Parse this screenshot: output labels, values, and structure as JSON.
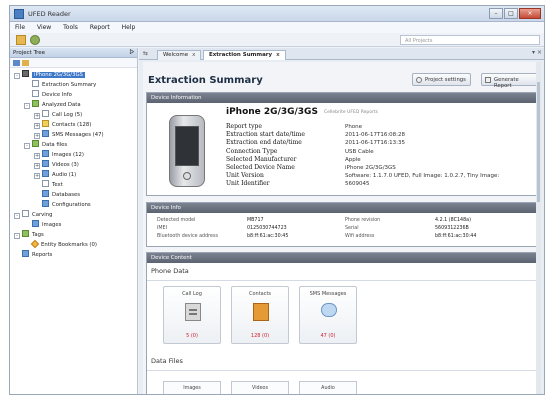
{
  "window": {
    "title": "UFED Reader"
  },
  "menu": [
    "File",
    "View",
    "Tools",
    "Report",
    "Help"
  ],
  "search": {
    "placeholder": "All Projects"
  },
  "left_panel": {
    "header": "Project Tree",
    "tree": [
      {
        "label": "iPhone 2G/3G/3GS",
        "level": 0,
        "icon": "phone-icon",
        "expander": "-",
        "selected": true
      },
      {
        "label": "Extraction Summary",
        "level": 1,
        "icon": "document-icon"
      },
      {
        "label": "Device Info",
        "level": 1,
        "icon": "document-icon"
      },
      {
        "label": "Analyzed Data",
        "level": 1,
        "icon": "analyzed-data-icon",
        "expander": "-"
      },
      {
        "label": "Call Log (5)",
        "level": 2,
        "icon": "call-log-icon",
        "expander": "+"
      },
      {
        "label": "Contacts (128)",
        "level": 2,
        "icon": "contacts-icon",
        "expander": "+"
      },
      {
        "label": "SMS Messages (47)",
        "level": 2,
        "icon": "sms-icon",
        "expander": "+"
      },
      {
        "label": "Data files",
        "level": 1,
        "icon": "data-files-icon",
        "expander": "-"
      },
      {
        "label": "Images (12)",
        "level": 2,
        "icon": "images-icon",
        "expander": "+"
      },
      {
        "label": "Videos (3)",
        "level": 2,
        "icon": "videos-icon",
        "expander": "+"
      },
      {
        "label": "Audio (1)",
        "level": 2,
        "icon": "audio-icon",
        "expander": "+"
      },
      {
        "label": "Text",
        "level": 2,
        "icon": "text-icon"
      },
      {
        "label": "Databases",
        "level": 2,
        "icon": "database-icon"
      },
      {
        "label": "Configurations",
        "level": 2,
        "icon": "configuration-icon"
      },
      {
        "label": "Carving",
        "level": 0,
        "icon": "carving-icon",
        "expander": "-"
      },
      {
        "label": "Images",
        "level": 1,
        "icon": "images-icon"
      },
      {
        "label": "Tags",
        "level": 0,
        "icon": "tags-icon",
        "expander": "-"
      },
      {
        "label": "Entity Bookmarks (0)",
        "level": 1,
        "icon": "bookmark-icon"
      },
      {
        "label": "Reports",
        "level": 0,
        "icon": "reports-icon"
      }
    ]
  },
  "tabs": [
    {
      "label": "Welcome",
      "close": "x"
    },
    {
      "label": "Extraction Summary",
      "close": "x"
    }
  ],
  "summary": {
    "title": "Extraction Summary",
    "project_settings": "Project settings",
    "generate_report": "Generate Report",
    "device_information": {
      "header": "Device Information",
      "device_title": "iPhone 2G/3G/3GS",
      "subtitle": "Cellebrite UFED Reports",
      "fields": [
        {
          "key": "Report type",
          "value": "Phone"
        },
        {
          "key": "Extraction start date/time",
          "value": "2011-06-17T16:08:28"
        },
        {
          "key": "Extraction end date/time",
          "value": "2011-06-17T16:13:35"
        },
        {
          "key": "Connection Type",
          "value": "USB Cable"
        },
        {
          "key": "Selected Manufacturer",
          "value": "Apple"
        },
        {
          "key": "Selected Device Name",
          "value": "iPhone 2G/3G/3GS"
        },
        {
          "key": "Unit Version",
          "value": "Software: 1.1.7.0 UFED, Full Image: 1.0.2.7, Tiny Image:"
        },
        {
          "key": "Unit Identifier",
          "value": "5609045"
        }
      ]
    },
    "device_info": {
      "header": "Device Info",
      "rows": [
        {
          "k1": "Detected model",
          "v1": "MB717",
          "k2": "Phone revision",
          "v2": "4.2.1 (8C148a)"
        },
        {
          "k1": "IMEI",
          "v1": "0125030744723",
          "k2": "Serial",
          "v2": "5609312236B"
        },
        {
          "k1": "Bluetooth device address",
          "v1": "b8:ff:61:ac:30:45",
          "k2": "Wifi address",
          "v2": "b8:ff:61:ac:30:44"
        }
      ]
    },
    "device_content": {
      "header": "Device Content",
      "phone_data_label": "Phone Data",
      "cards": [
        {
          "label": "Call Log",
          "count": "5 (0)",
          "icon": "call-log-icon"
        },
        {
          "label": "Contacts",
          "count": "128 (0)",
          "icon": "contacts-icon"
        },
        {
          "label": "SMS Messages",
          "count": "47 (0)",
          "icon": "sms-icon"
        }
      ],
      "data_files_label": "Data Files",
      "data_file_cards": [
        "Images",
        "Videos",
        "Audio"
      ]
    }
  },
  "colors": {
    "section_header": "#6a717e",
    "selection": "#3d77c7",
    "count_red": "#cc2233"
  }
}
